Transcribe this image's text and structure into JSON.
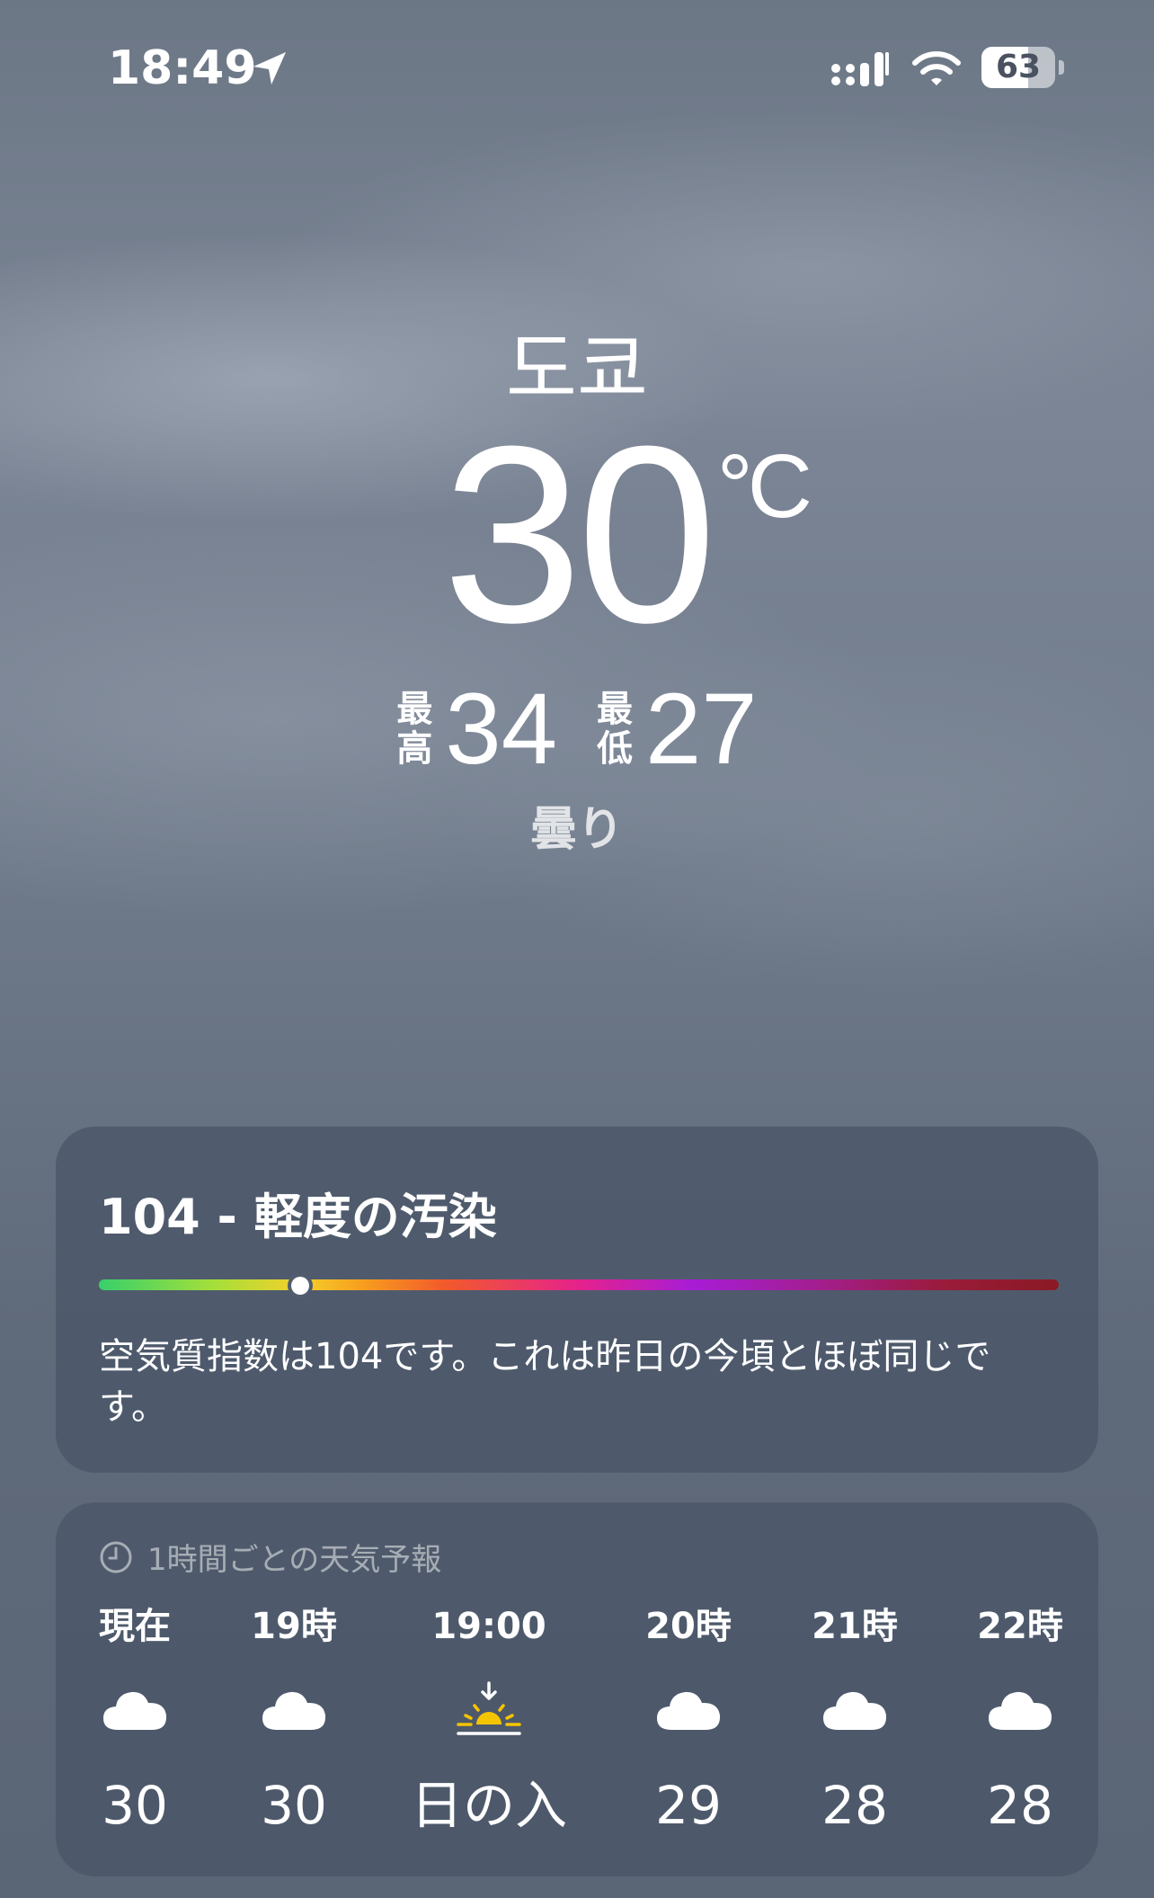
{
  "status_bar": {
    "time": "18:49",
    "battery": "63",
    "battery_level": 0.63
  },
  "header": {
    "city": "도쿄",
    "temperature": "30",
    "unit": "°C",
    "high_label": "最\n高",
    "high_value": "34",
    "low_label": "最\n低",
    "low_value": "27",
    "condition": "曇り"
  },
  "air_quality": {
    "title": "104 - 軽度の汚染",
    "index": 104,
    "scale_position": 0.21,
    "description": "空気質指数は104です。これは昨日の今頃とほぼ同じです。"
  },
  "hourly": {
    "header": "1時間ごとの天気予報",
    "items": [
      {
        "label": "現在",
        "icon": "cloud-icon",
        "value": "30"
      },
      {
        "label": "19時",
        "icon": "cloud-icon",
        "value": "30"
      },
      {
        "label": "19:00",
        "icon": "sunset-icon",
        "value": "日の入"
      },
      {
        "label": "20時",
        "icon": "cloud-icon",
        "value": "29"
      },
      {
        "label": "21時",
        "icon": "cloud-icon",
        "value": "28"
      },
      {
        "label": "22時",
        "icon": "cloud-icon",
        "value": "28"
      }
    ]
  },
  "colors": {
    "sun": "#f5c400",
    "card": "#485466"
  }
}
